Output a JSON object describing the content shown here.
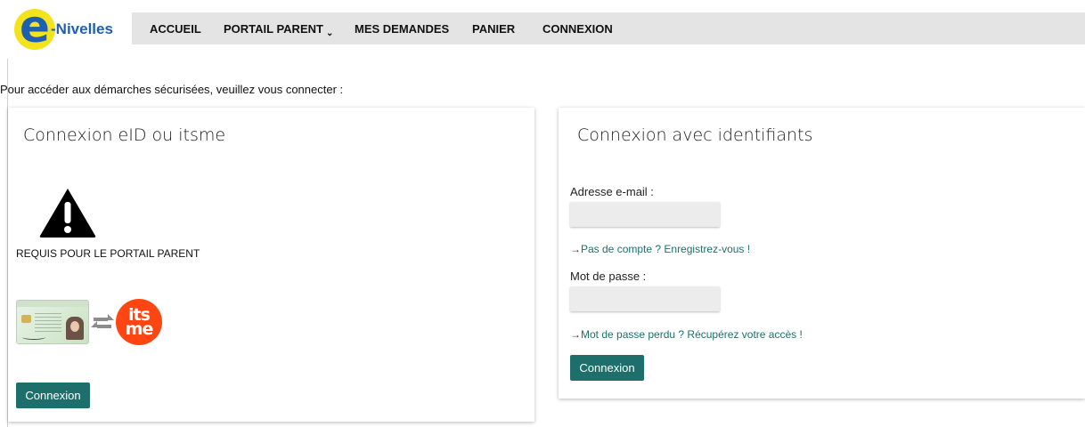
{
  "header": {
    "logo_letter": "e",
    "logo_word": "-Nivelles",
    "nav": [
      {
        "label": "ACCUEIL"
      },
      {
        "label": "PORTAIL PARENT",
        "caret": "⌄"
      },
      {
        "label": "MES DEMANDES"
      },
      {
        "label": "PANIER"
      },
      {
        "label": "CONNEXION"
      }
    ]
  },
  "intro_text": "Pour accéder aux démarches sécurisées, veuillez vous connecter :",
  "eid_panel": {
    "title": "Connexion eID ou itsme",
    "warning_icon": "warning-icon",
    "requirement_text": "REQUIS POUR LE PORTAIL PARENT",
    "itsme_logo_text": "its me",
    "button_label": "Connexion"
  },
  "credentials_panel": {
    "title": "Connexion avec identifiants",
    "email_label": "Adresse e-mail :",
    "email_value": "",
    "register_link": {
      "arrow": "→",
      "text": "Pas de compte ? Enregistrez-vous !"
    },
    "password_label": "Mot de passe :",
    "password_value": "",
    "forgot_link": {
      "arrow": "→",
      "text": "Mot de passe perdu ? Récupérez votre accès !"
    },
    "button_label": "Connexion"
  },
  "colors": {
    "accent": "#1e6f6b",
    "logo_yellow": "#f4e21c",
    "logo_blue": "#1f5fb0",
    "itsme_orange": "#ff4612",
    "navbar_bg": "#e4e4e4"
  }
}
